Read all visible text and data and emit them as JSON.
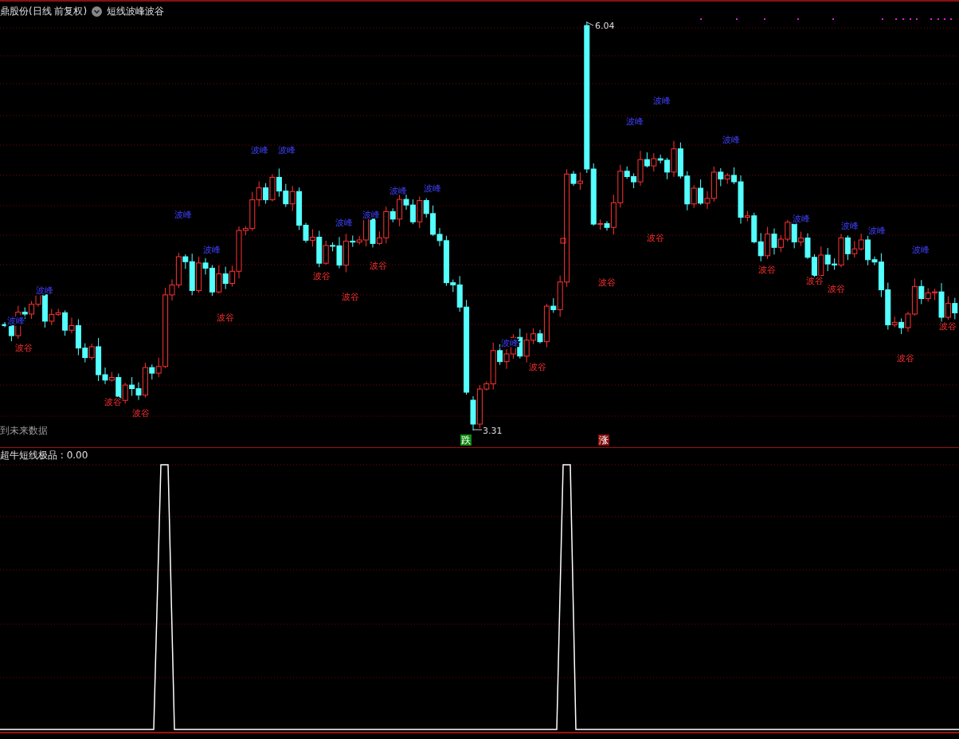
{
  "header": {
    "stock": "鼎股份(日线 前复权)",
    "indicator": "短线波峰波谷"
  },
  "main_chart": {
    "peak_labels": [
      "波峰",
      "波峰",
      "波峰",
      "波峰",
      "波峰",
      "波峰",
      "波峰",
      "波峰",
      "波峰",
      "波峰",
      "波峰",
      "波峰",
      "波峰",
      "波峰",
      "波峰",
      "波峰",
      "波峰",
      "波峰"
    ],
    "trough_labels": [
      "波谷",
      "波谷",
      "波谷",
      "波谷",
      "波谷",
      "波谷",
      "波谷",
      "波谷",
      "波谷",
      "波谷",
      "波谷",
      "波谷",
      "波谷",
      "波谷",
      "波谷"
    ],
    "high": "6.04",
    "low": "3.31",
    "signals": [
      {
        "text": "跌",
        "kind": "fall"
      },
      {
        "text": "涨",
        "kind": "rise"
      }
    ],
    "note": "到未来数据"
  },
  "sub_chart": {
    "label": "超牛短线极品 : 0.00"
  }
}
